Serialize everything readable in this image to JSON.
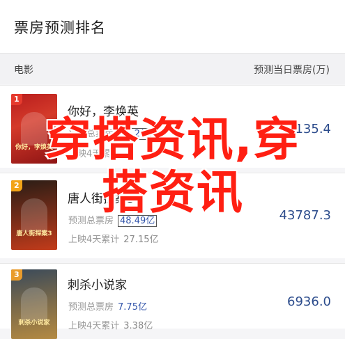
{
  "header": {
    "title": "票房预测排名"
  },
  "columns": {
    "movie": "电影",
    "forecast": "预测当日票房(万)"
  },
  "movies": [
    {
      "rank": "1",
      "name": "你好，李焕英",
      "poster_text": "你好，李焕英",
      "forecast_total_label": "预测总票房",
      "forecast_total_value": "45.2亿",
      "cumulative_label": "上映4天累计",
      "cumulative_value": "",
      "daily_forecast": "46135.4"
    },
    {
      "rank": "2",
      "name": "唐人街探案3",
      "poster_text": "唐人街探案3",
      "forecast_total_label": "预测总票房",
      "forecast_total_value": "48.49亿",
      "cumulative_label": "上映4天累计",
      "cumulative_value": "27.15亿",
      "daily_forecast": "43787.3"
    },
    {
      "rank": "3",
      "name": "刺杀小说家",
      "poster_text": "刺杀小说家",
      "forecast_total_label": "预测总票房",
      "forecast_total_value": "7.75亿",
      "cumulative_label": "上映4天累计",
      "cumulative_value": "3.38亿",
      "daily_forecast": "6936.0"
    }
  ],
  "watermark": {
    "line1": "穿搭资讯,穿",
    "line2": "搭资讯"
  },
  "colors": {
    "accent_blue": "#2c4c8c",
    "rank1": "#e63b2e",
    "rank2": "#f2a417",
    "rank3": "#e99b2c",
    "watermark": "#ff1f12"
  }
}
